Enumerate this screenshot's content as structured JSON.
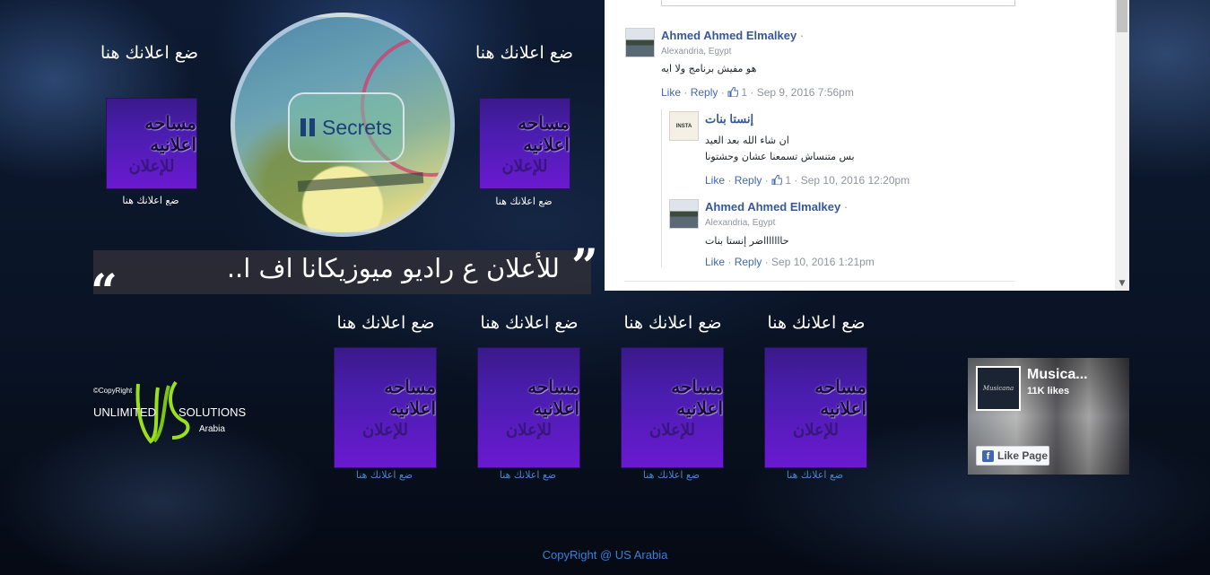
{
  "top_left_ad": {
    "title": "ضع اعلانك هنا",
    "box_line1": "مساحه اعلانيه",
    "box_line2": "للإعلان",
    "caption": "ضع اعلانك هنا"
  },
  "top_right_ad": {
    "title": "ضع اعلانك هنا",
    "box_line1": "مساحه اعلانيه",
    "box_line2": "للإعلان",
    "caption": "ضع اعلانك هنا"
  },
  "player": {
    "button_label": "Secrets"
  },
  "banner": {
    "text": "للأعلان ع راديو ميوزيكانا اف ا..",
    "open_quote": "“",
    "close_quote": "”"
  },
  "comments": [
    {
      "name": "Ahmed Ahmed Elmalkey",
      "location": "Alexandria, Egypt",
      "text": "هو مفيش برنامج ولا ايه",
      "like": "Like",
      "reply": "Reply",
      "likes": "1",
      "time": "Sep 9, 2016 7:56pm"
    },
    {
      "name": "إنستا بنات",
      "avatar_text": "INSTA",
      "text_line1": "ان شاء الله بعد العيد",
      "text_line2": "بس متنساش تسمعنا عشان وحشتونا",
      "like": "Like",
      "reply": "Reply",
      "likes": "1",
      "time": "Sep 10, 2016 12:20pm"
    },
    {
      "name": "Ahmed Ahmed Elmalkey",
      "location": "Alexandria, Egypt",
      "text": "حاااااااضر إنستا بنات",
      "like": "Like",
      "reply": "Reply",
      "time": "Sep 10, 2016 1:21pm"
    }
  ],
  "logo": {
    "copyright": "©CopyRight",
    "word1": "UNLIMITED",
    "word2": "SOLUTIONS",
    "word3": "Arabia"
  },
  "bottom_ads": [
    {
      "title": "ضع اعلانك هنا",
      "box_line1": "مساحه اعلانيه",
      "box_line2": "للإعلان",
      "caption": "ضع اعلانك هنا"
    },
    {
      "title": "ضع اعلانك هنا",
      "box_line1": "مساحه اعلانيه",
      "box_line2": "للإعلان",
      "caption": "ضع اعلانك هنا"
    },
    {
      "title": "ضع اعلانك هنا",
      "box_line1": "مساحه اعلانيه",
      "box_line2": "للإعلان",
      "caption": "ضع اعلانك هنا"
    },
    {
      "title": "ضع اعلانك هنا",
      "box_line1": "مساحه اعلانيه",
      "box_line2": "للإعلان",
      "caption": "ضع اعلانك هنا"
    }
  ],
  "fb_page": {
    "name": "Musica...",
    "likes": "11K likes",
    "button": "Like Page",
    "thumb_text": "Musicana"
  },
  "footer": {
    "text": "CopyRight @ US Arabia"
  },
  "colors": {
    "link": "#4267b2",
    "name": "#365899",
    "footer": "#3c7fd6",
    "ad_purple": "#4b1db0"
  }
}
